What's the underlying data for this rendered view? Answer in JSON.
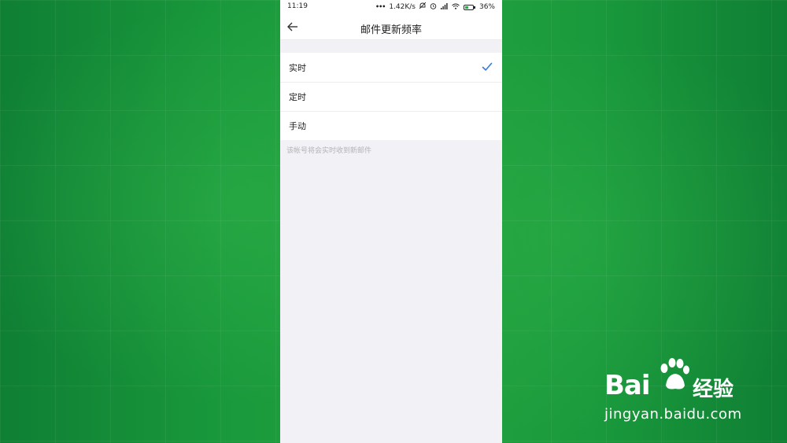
{
  "status_bar": {
    "time": "11:19",
    "speed": "1.42K/s",
    "battery_pct": "36%",
    "battery_level": 0.36,
    "icons": [
      "more-dots-icon",
      "mute-icon",
      "alarm-icon",
      "signal-icon",
      "wifi-icon",
      "battery-icon"
    ]
  },
  "navbar": {
    "back_icon": "arrow-left-icon",
    "title": "邮件更新频率"
  },
  "options": [
    {
      "label": "实时",
      "selected": true
    },
    {
      "label": "定时",
      "selected": false
    },
    {
      "label": "手动",
      "selected": false
    }
  ],
  "hint": "该帐号将会实时收到新邮件",
  "watermark": {
    "brand": "Bai",
    "brand_suffix": "经验",
    "url": "jingyan.baidu.com"
  },
  "colors": {
    "accent": "#3a7bd5",
    "background_green": "#19963a"
  }
}
